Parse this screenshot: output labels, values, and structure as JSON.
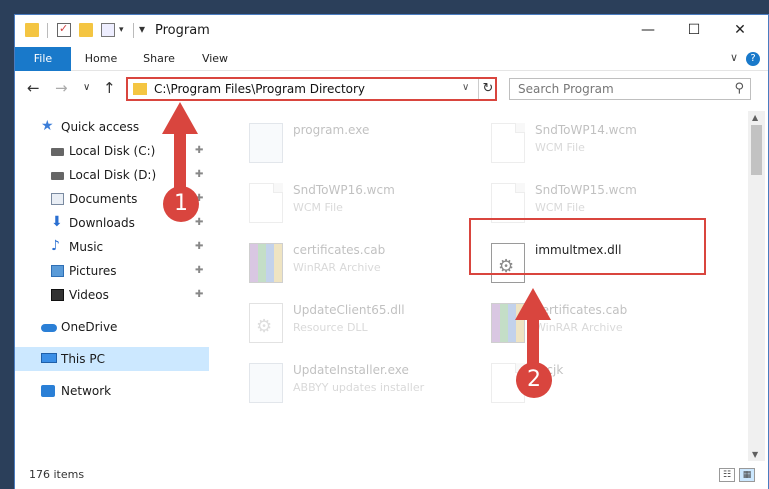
{
  "window": {
    "title": "Program",
    "controls": {
      "minimize": "—",
      "maximize": "☐",
      "close": "✕"
    }
  },
  "ribbon": {
    "tabs": [
      "File",
      "Home",
      "Share",
      "View"
    ],
    "help": "?",
    "collapse": "∨"
  },
  "navigation": {
    "back": "←",
    "forward": "→",
    "recent": "∨",
    "up": "↑",
    "address": "C:\\Program Files\\Program Directory",
    "address_dropdown": "∨",
    "refresh": "↻",
    "search_placeholder": "Search Program",
    "search_icon": "⚲"
  },
  "sidebar": {
    "items": [
      {
        "label": "Quick access",
        "icon": "star-icon",
        "pinned": false
      },
      {
        "label": "Local Disk (C:)",
        "icon": "drive-icon",
        "pinned": true
      },
      {
        "label": "Local Disk (D:)",
        "icon": "drive-icon",
        "pinned": true
      },
      {
        "label": "Documents",
        "icon": "documents-icon",
        "pinned": true
      },
      {
        "label": "Downloads",
        "icon": "download-icon",
        "pinned": true
      },
      {
        "label": "Music",
        "icon": "music-icon",
        "pinned": true
      },
      {
        "label": "Pictures",
        "icon": "pictures-icon",
        "pinned": true
      },
      {
        "label": "Videos",
        "icon": "videos-icon",
        "pinned": true
      },
      {
        "label": "OneDrive",
        "icon": "onedrive-icon",
        "pinned": false
      },
      {
        "label": "This PC",
        "icon": "pc-icon",
        "pinned": false
      },
      {
        "label": "Network",
        "icon": "network-icon",
        "pinned": false
      }
    ],
    "pin_glyph": "📌"
  },
  "files": [
    {
      "name": "program.exe",
      "type": "",
      "faded": true
    },
    {
      "name": "SndToWP14.wcm",
      "type": "WCM File",
      "faded": true
    },
    {
      "name": "SndToWP16.wcm",
      "type": "WCM File",
      "faded": true
    },
    {
      "name": "SndToWP15.wcm",
      "type": "WCM File",
      "faded": true
    },
    {
      "name": "certificates.cab",
      "type": "WinRAR Archive",
      "faded": true
    },
    {
      "name": "immultmex.dll",
      "type": "",
      "faded": false
    },
    {
      "name": "UpdateClient65.dll",
      "type": "Resource DLL",
      "faded": true
    },
    {
      "name": "certificates.cab",
      "type": "WinRAR Archive",
      "faded": true
    },
    {
      "name": "UpdateInstaller.exe",
      "type": "ABBYY updates installer",
      "faded": true
    },
    {
      "name": "d.cjk",
      "type": "",
      "faded": true
    }
  ],
  "status": {
    "item_count": "176 items",
    "view_details": "☷",
    "view_large": "▦"
  },
  "callouts": {
    "one": "1",
    "two": "2"
  },
  "colors": {
    "accent": "#1979ca",
    "highlight": "#d9453e",
    "selected": "#cce8ff"
  }
}
